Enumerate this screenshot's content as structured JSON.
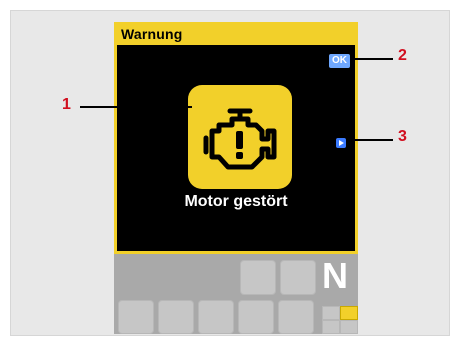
{
  "display": {
    "title": "Warnung",
    "ok_label": "OK",
    "warning_message": "Motor gestört",
    "gear": "N"
  },
  "callouts": {
    "c1": "1",
    "c2": "2",
    "c3": "3"
  },
  "icons": {
    "engine": "engine-warning-icon",
    "next": "next-arrow-icon"
  },
  "colors": {
    "warning_yellow": "#f2d02a",
    "ok_blue": "#6fa8ff",
    "arrow_blue": "#3b7bff",
    "callout_red": "#d10f1f"
  }
}
